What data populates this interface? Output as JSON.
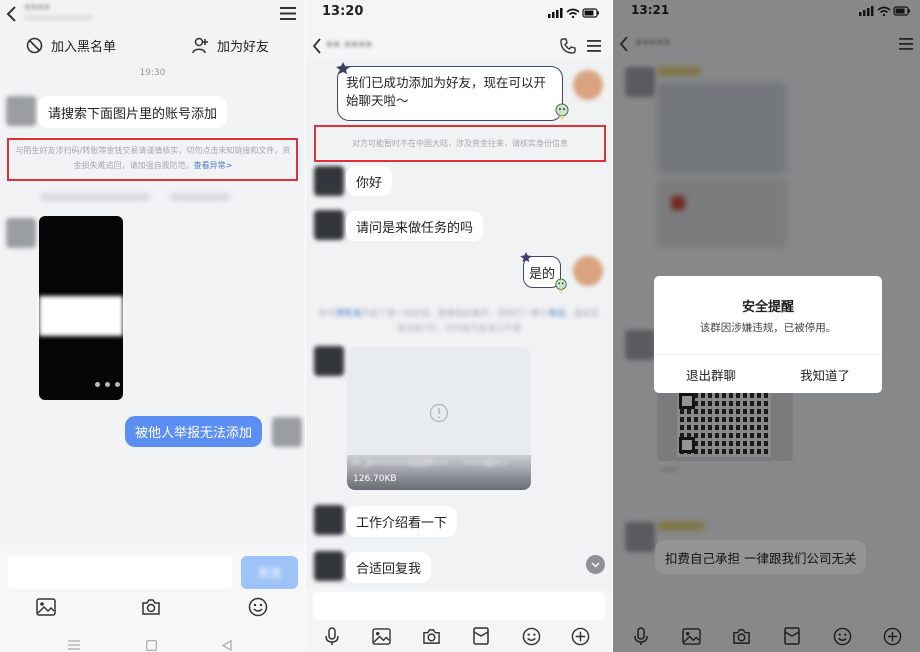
{
  "panel1": {
    "contact_name": "••••",
    "contact_sub": "•••••••••••••",
    "actions": {
      "blacklist": "加入黑名单",
      "add_friend": "加为好友"
    },
    "timestamp": "19:30",
    "msg_search": "请搜索下面图片里的账号添加",
    "warning_text": "与陌生好友涉扫码/转账等金钱交易请谨慎核实，切勿点击未知链接和文件，资金损失难追回，请加强自我防范。",
    "warning_link": "查看异常>",
    "msg_reported": "被他人举报无法添加",
    "send_button": "发送"
  },
  "panel2": {
    "time": "13:20",
    "contact_name": "•• ••••",
    "msg_added": "我们已成功添加为好友，现在可以开始聊天啦～",
    "warning_text": "对方可能暂时不在中国大陆，涉及资金往来，请核实身份信息",
    "msg_hello": "你好",
    "msg_task": "请问是来做任务的吗",
    "msg_yes": "是的",
    "system_note_pre": "你与",
    "system_note_name": "预死鬼",
    "system_note_mid": "开启了第一句对话，故事就此展开，进你们一颗小",
    "system_note_luck": "幸运",
    "system_note_post": "，连续互发消息7天，可升级为友谊三叶草",
    "file_name": "f•_0•••••••024ff••• ... ••••4b•.•",
    "file_size": "126.70KB",
    "msg_intro": "工作介绍看一下",
    "msg_reply": "合适回复我"
  },
  "panel3": {
    "time": "13:21",
    "group_name": "•••••",
    "dialog": {
      "title": "安全提醒",
      "message": "该群因涉嫌违规，已被停用。",
      "btn_exit": "退出群聊",
      "btn_ok": "我知道了"
    },
    "msg_fee": "扣费自己承担 一律跟我们公司无关",
    "caption_blur": "•••"
  },
  "colors": {
    "warning_red": "#e0313a",
    "bubble_blue": "#5b8ff4",
    "link_blue": "#4a78c9"
  }
}
